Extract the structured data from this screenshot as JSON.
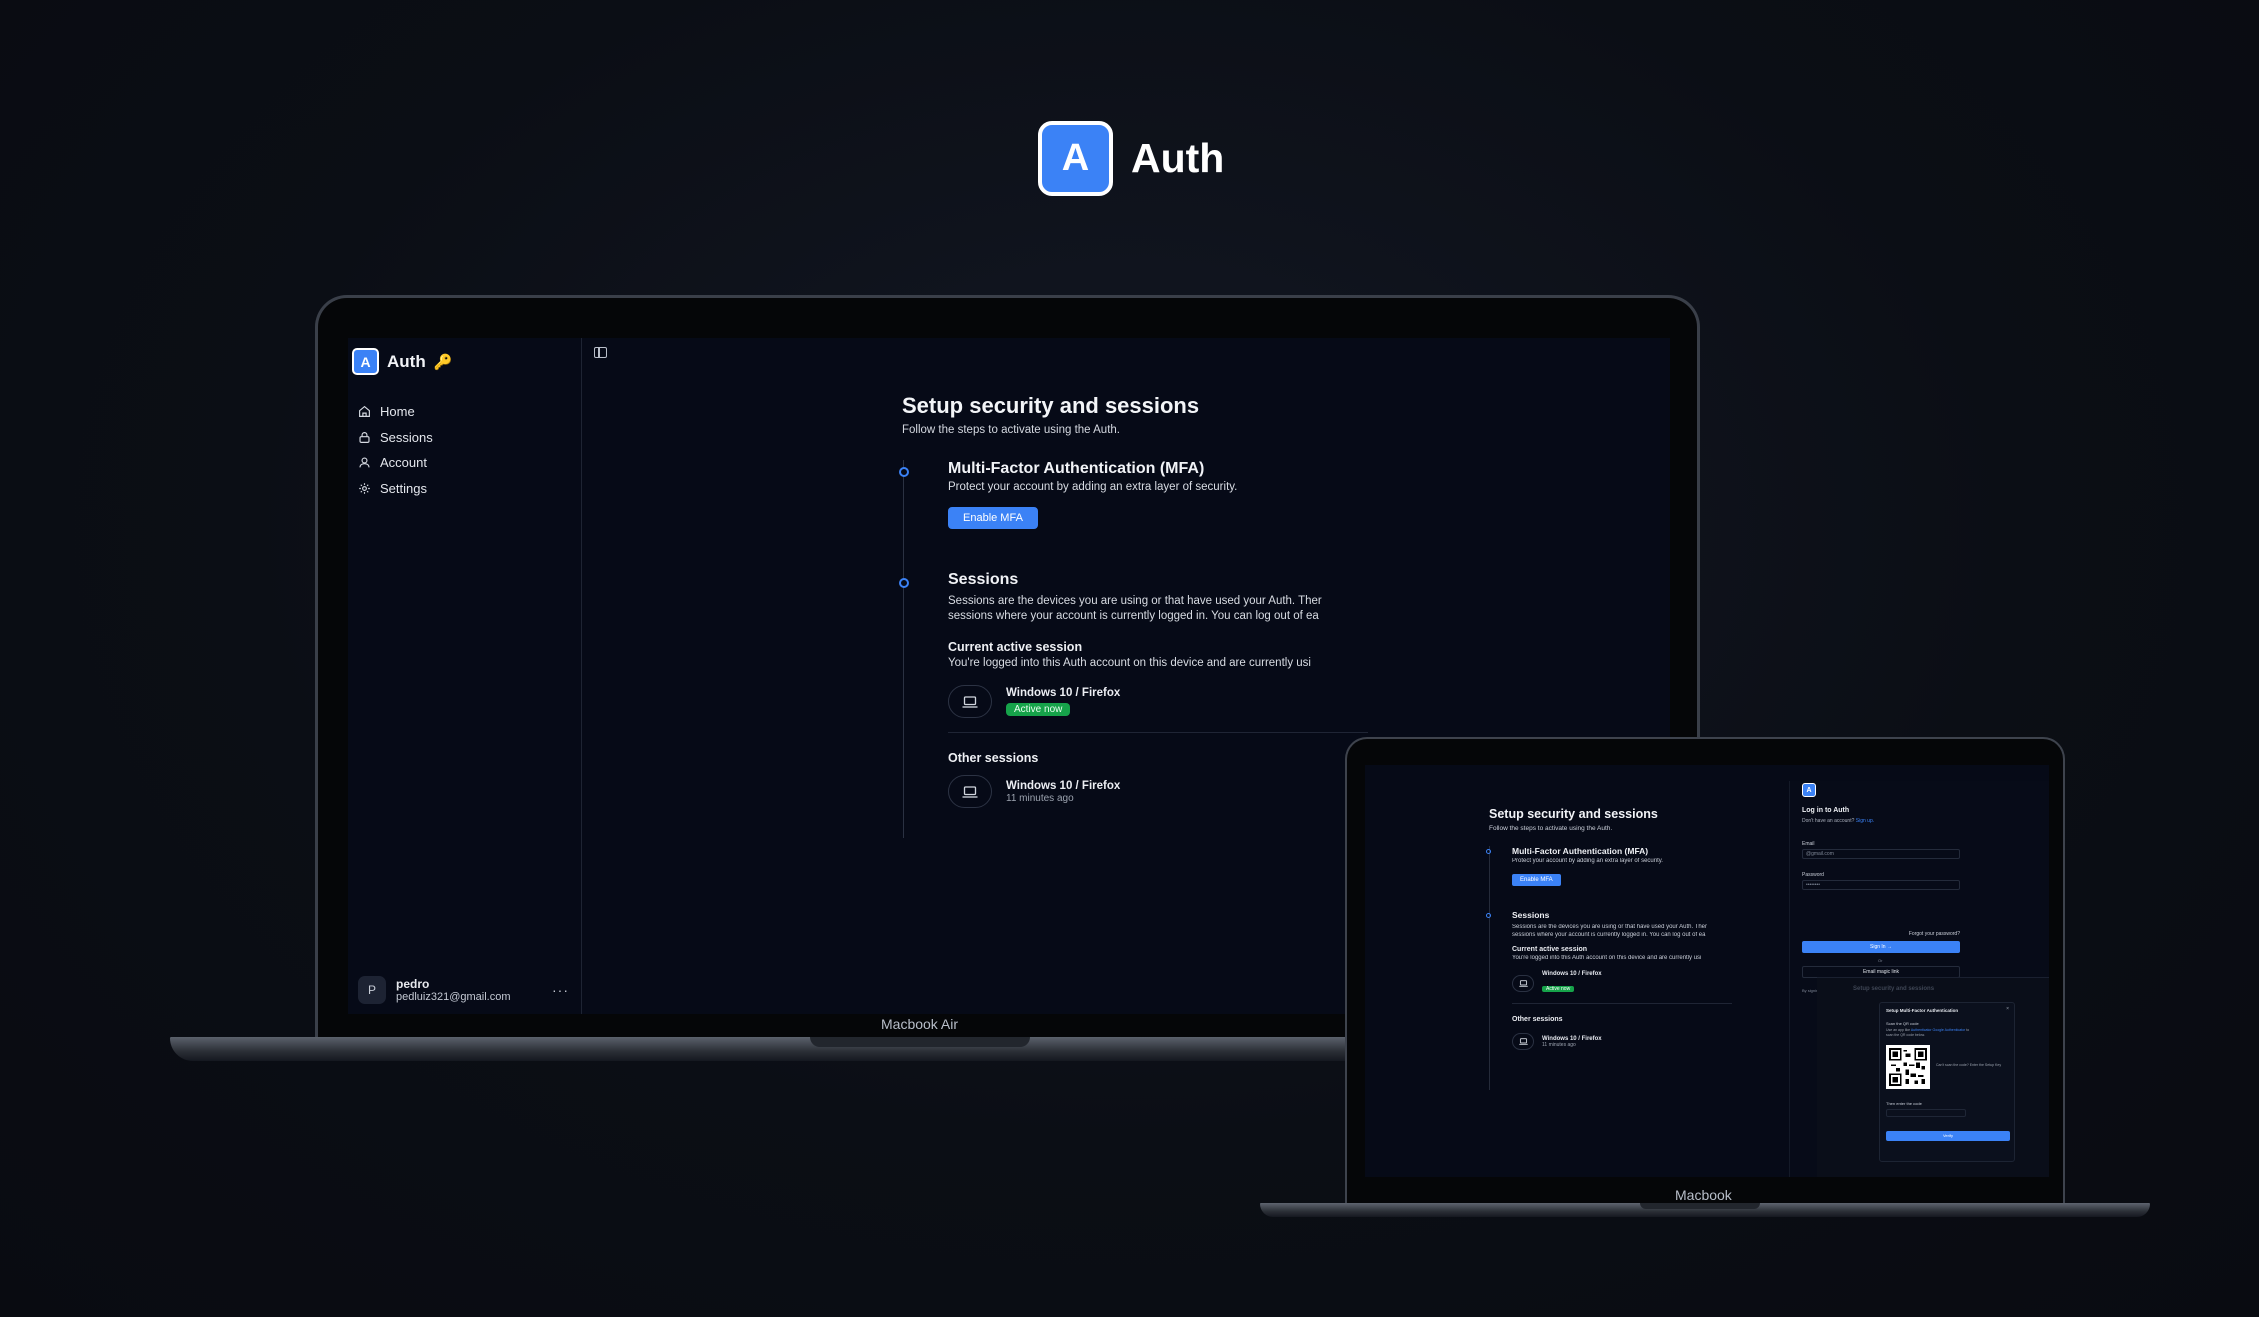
{
  "brand": {
    "logo_letter": "A",
    "name": "Auth",
    "accent": "#3b82f6"
  },
  "app": {
    "logo_letter": "A",
    "title": "Auth",
    "title_emoji": "🔑",
    "nav": [
      {
        "label": "Home",
        "icon": "home-icon"
      },
      {
        "label": "Sessions",
        "icon": "lock-icon"
      },
      {
        "label": "Account",
        "icon": "user-icon"
      },
      {
        "label": "Settings",
        "icon": "gear-icon"
      }
    ],
    "user": {
      "initial": "P",
      "name": "pedro",
      "email": "pedluiz321@gmail.com",
      "more": "···"
    }
  },
  "page": {
    "title": "Setup security and sessions",
    "subtitle": "Follow the steps to activate using the Auth.",
    "mfa": {
      "title": "Multi-Factor Authentication (MFA)",
      "description": "Protect your account by adding an extra layer of security.",
      "button": "Enable MFA"
    },
    "sessions": {
      "title": "Sessions",
      "description_line1": "Sessions are the devices you are using or that have used your Auth. Ther",
      "description_line2": "sessions where your account is currently logged in. You can log out of ea",
      "current_heading": "Current active session",
      "current_description": "You're logged into this Auth account on this device and are currently usi",
      "current_device": "Windows 10 / Firefox",
      "current_status": "Active now",
      "other_heading": "Other sessions",
      "other_device": "Windows 10 / Firefox",
      "other_time": "11 minutes ago"
    }
  },
  "small": {
    "other_time": "11 minutes ago",
    "login": {
      "logo_letter": "A",
      "title": "Log in to Auth",
      "no_account": "Don't have an account?",
      "sign_up": "Sign up.",
      "email_label": "Email",
      "email_placeholder": "@gmail.com",
      "password_label": "Password",
      "password_placeholder": "••••••••",
      "forgot": "Forgot your password?",
      "sign_in": "Sign In →",
      "or": "Or",
      "magic_link": "Email magic link",
      "terms": "By signing u"
    },
    "overlay_title": "Setup security and sessions",
    "modal": {
      "title": "Setup Multi-Factor Authentication",
      "close": "×",
      "step1": "Scan the QR code",
      "step1_text": "Use an app like",
      "app1": "Authenticator",
      "app2": "Google Authenticator",
      "step1_suffix": "to scan the QR code below.",
      "hint": "Can't scan the code? Enter the Setup Key",
      "code_label": "Then enter the code",
      "verify": "Verify"
    }
  },
  "devices": {
    "big_label": "Macbook Air",
    "small_label": "Macbook"
  }
}
